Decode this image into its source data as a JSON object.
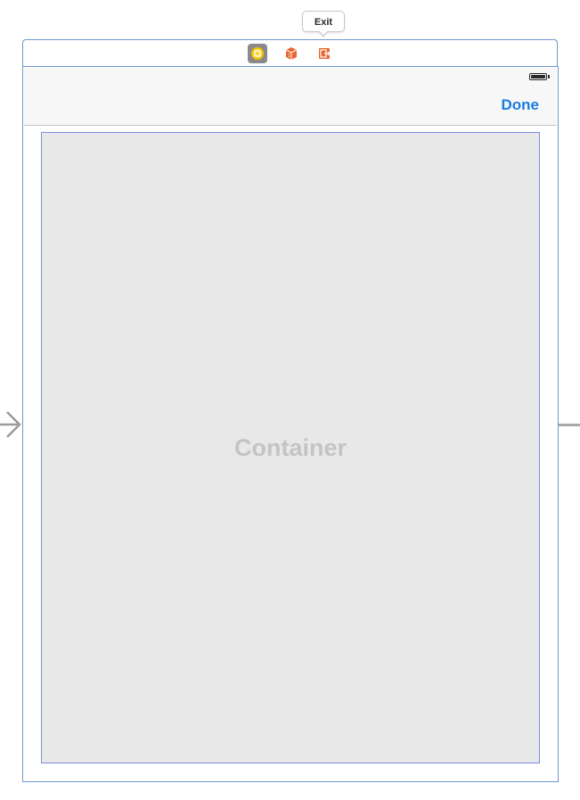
{
  "tooltip": {
    "label": "Exit"
  },
  "scene_dock": {
    "icons": [
      {
        "name": "view-controller-icon",
        "color": "#f5c400",
        "background": "#8a8a8a"
      },
      {
        "name": "first-responder-icon",
        "color": "#e8652f"
      },
      {
        "name": "exit-icon",
        "color": "#e8652f"
      }
    ]
  },
  "status_bar": {
    "battery_icon": "battery-icon"
  },
  "nav_bar": {
    "done_label": "Done",
    "accent_color": "#1a7be0"
  },
  "container": {
    "label": "Container",
    "background": "#e8e8e8",
    "border_color": "#7b8ee0"
  },
  "scene": {
    "border_color": "#6f97cf"
  }
}
